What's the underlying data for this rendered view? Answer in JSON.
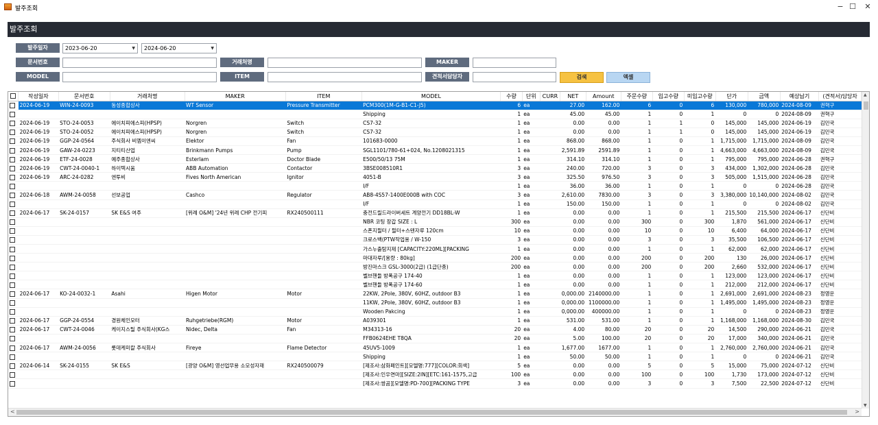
{
  "window": {
    "title": "발주조회",
    "min": "−",
    "max": "☐",
    "close": "✕"
  },
  "header": {
    "title": "발주조회"
  },
  "filters": {
    "order_date_label": "발주일자",
    "date_from": "2023-06-20",
    "date_to": "2024-06-20",
    "doc_no_label": "문서번호",
    "doc_no_value": "",
    "vendor_label": "거래처명",
    "vendor_value": "",
    "maker_label": "MAKER",
    "maker_value": "",
    "model_label": "MODEL",
    "model_value": "",
    "item_label": "ITEM",
    "item_value": "",
    "quote_mgr_label": "견적서담당자",
    "quote_mgr_value": "",
    "search_button": "검색",
    "excel_button": "엑셀"
  },
  "grid": {
    "columns": [
      "작성일자",
      "문서번호",
      "거래처명",
      "MAKER",
      "ITEM",
      "MODEL",
      "수량",
      "단위",
      "CURR",
      "NET",
      "Amount",
      "주문수량",
      "입고수량",
      "미입고수량",
      "단가",
      "금액",
      "예상납기",
      "(견적서)담당자"
    ],
    "rows": [
      [
        "2024-06-19",
        "WIN-24-0093",
        "동성종합상사",
        "WT Sensor",
        "Pressure Transmitter",
        "PCM300(1M-G-B1-C1-J5)",
        "6",
        "ea",
        "",
        "27.00",
        "162.00",
        "6",
        "0",
        "6",
        "130,000",
        "780,000",
        "2024-08-09",
        "권혁구"
      ],
      [
        "",
        "",
        "",
        "",
        "",
        "Shipping",
        "1",
        "ea",
        "",
        "45.00",
        "45.00",
        "1",
        "0",
        "1",
        "0",
        "0",
        "2024-08-09",
        "권혁구"
      ],
      [
        "2024-06-19",
        "STO-24-0053",
        "에이치피에스피(HPSP)",
        "Norgren",
        "Switch",
        "CS7-32",
        "1",
        "ea",
        "",
        "0.00",
        "0.00",
        "1",
        "1",
        "0",
        "145,000",
        "145,000",
        "2024-06-19",
        "김민국"
      ],
      [
        "2024-06-19",
        "STO-24-0052",
        "에이치피에스피(HPSP)",
        "Norgren",
        "Switch",
        "CS7-32",
        "1",
        "ea",
        "",
        "0.00",
        "0.00",
        "1",
        "1",
        "0",
        "145,000",
        "145,000",
        "2024-06-19",
        "김민국"
      ],
      [
        "2024-06-19",
        "GGP-24-0564",
        "주식회사 비엠이엔씨",
        "Elektor",
        "Fan",
        "101683-0000",
        "1",
        "ea",
        "",
        "868.00",
        "868.00",
        "1",
        "0",
        "1",
        "1,715,000",
        "1,715,000",
        "2024-08-09",
        "김민국"
      ],
      [
        "2024-06-19",
        "GAW-24-0223",
        "지티티산업",
        "Brinkmann Pumps",
        "Pump",
        "SGL1101/780-61+024, No.1208021315",
        "1",
        "ea",
        "",
        "2,591.89",
        "2591.89",
        "1",
        "0",
        "1",
        "4,663,000",
        "4,663,000",
        "2024-08-09",
        "김민국"
      ],
      [
        "2024-06-19",
        "ETF-24-0028",
        "예주종합상사",
        "Esterlam",
        "Doctor Blade",
        "E500/50/13 75M",
        "1",
        "ea",
        "",
        "314.10",
        "314.10",
        "1",
        "0",
        "1",
        "795,000",
        "795,000",
        "2024-06-28",
        "권혁구"
      ],
      [
        "2024-06-19",
        "CWT-24-0040-1",
        "하이텍시움",
        "ABB Automation",
        "Contactor",
        "3BSE008510R1",
        "3",
        "ea",
        "",
        "240.00",
        "720.00",
        "3",
        "0",
        "3",
        "434,000",
        "1,302,000",
        "2024-06-28",
        "김민국"
      ],
      [
        "2024-06-19",
        "ARC-24-0282",
        "엔투비",
        "Fives North American",
        "Ignitor",
        "4051-B",
        "3",
        "ea",
        "",
        "325.50",
        "976.50",
        "3",
        "0",
        "3",
        "505,000",
        "1,515,000",
        "2024-06-28",
        "김민국"
      ],
      [
        "",
        "",
        "",
        "",
        "",
        "I/F",
        "1",
        "ea",
        "",
        "36.00",
        "36.00",
        "1",
        "0",
        "1",
        "0",
        "0",
        "2024-06-28",
        "김민국"
      ],
      [
        "2024-06-18",
        "AWM-24-0058",
        "선보공업",
        "Cashco",
        "Regulator",
        "AB8-4S57-1400E000B with COC",
        "3",
        "ea",
        "",
        "2,610.00",
        "7830.00",
        "3",
        "0",
        "3",
        "3,380,000",
        "10,140,000",
        "2024-08-02",
        "김민국"
      ],
      [
        "",
        "",
        "",
        "",
        "",
        "I/F",
        "1",
        "ea",
        "",
        "150.00",
        "150.00",
        "1",
        "0",
        "1",
        "0",
        "0",
        "2024-08-02",
        "김민국"
      ],
      [
        "2024-06-17",
        "SK-24-0157",
        "SK E&S 여주",
        "[위례 O&M] '24년 위례 CHP 전기피",
        "RX240500111",
        "충전드릴드라이버세트 계양전기 DD18BL-W",
        "1",
        "ea",
        "",
        "0.00",
        "0.00",
        "1",
        "0",
        "1",
        "215,500",
        "215,500",
        "2024-06-17",
        "신단비"
      ],
      [
        "",
        "",
        "",
        "",
        "",
        "NBR 코팅 장갑 SIZE : L",
        "300",
        "ea",
        "",
        "0.00",
        "0.00",
        "300",
        "0",
        "300",
        "1,870",
        "561,000",
        "2024-06-17",
        "신단비"
      ],
      [
        "",
        "",
        "",
        "",
        "",
        "스폰지필터 / 필터+스텐자루 120cm",
        "10",
        "ea",
        "",
        "0.00",
        "0.00",
        "10",
        "0",
        "10",
        "6,400",
        "64,000",
        "2024-06-17",
        "신단비"
      ],
      [
        "",
        "",
        "",
        "",
        "",
        "크로스백(PTW작업용 / W-150",
        "3",
        "ea",
        "",
        "0.00",
        "0.00",
        "3",
        "0",
        "3",
        "35,500",
        "106,500",
        "2024-06-17",
        "신단비"
      ],
      [
        "",
        "",
        "",
        "",
        "",
        "가스누출탐지제 [CAPACITY:220ML][PACKING",
        "1",
        "ea",
        "",
        "0.00",
        "0.00",
        "1",
        "0",
        "1",
        "62,000",
        "62,000",
        "2024-06-17",
        "신단비"
      ],
      [
        "",
        "",
        "",
        "",
        "",
        "마대자루/[용량 : 80kg]",
        "200",
        "ea",
        "",
        "0.00",
        "0.00",
        "200",
        "0",
        "200",
        "130",
        "26,000",
        "2024-06-17",
        "신단비"
      ],
      [
        "",
        "",
        "",
        "",
        "",
        "방진마스크 GSL-3000(2급) (1급단종)",
        "200",
        "ea",
        "",
        "0.00",
        "0.00",
        "200",
        "0",
        "200",
        "2,660",
        "532,000",
        "2024-06-17",
        "신단비"
      ],
      [
        "",
        "",
        "",
        "",
        "",
        "벨브핸들 방폭공구 174-40",
        "1",
        "ea",
        "",
        "0.00",
        "0.00",
        "1",
        "0",
        "1",
        "123,000",
        "123,000",
        "2024-06-17",
        "신단비"
      ],
      [
        "",
        "",
        "",
        "",
        "",
        "벨브핸들 방폭공구 174-60",
        "1",
        "ea",
        "",
        "0.00",
        "0.00",
        "1",
        "0",
        "1",
        "212,000",
        "212,000",
        "2024-06-17",
        "신단비"
      ],
      [
        "2024-06-17",
        "KO-24-0032-1",
        "Asahi",
        "Higen Motor",
        "Motor",
        "22KW, 2Pole, 380V, 60HZ, outdoor B3",
        "1",
        "ea",
        "",
        "0,000.00",
        "2140000.00",
        "1",
        "0",
        "1",
        "2,691,000",
        "2,691,000",
        "2024-08-23",
        "정영운"
      ],
      [
        "",
        "",
        "",
        "",
        "",
        "11KW, 2Pole, 380V, 60HZ, outdoor B3",
        "1",
        "ea",
        "",
        "0,000.00",
        "1100000.00",
        "1",
        "0",
        "1",
        "1,495,000",
        "1,495,000",
        "2024-08-23",
        "정영운"
      ],
      [
        "",
        "",
        "",
        "",
        "",
        "Wooden Pakcing",
        "1",
        "ea",
        "",
        "0,000.00",
        "400000.00",
        "1",
        "0",
        "1",
        "0",
        "0",
        "2024-08-23",
        "정영운"
      ],
      [
        "2024-06-17",
        "GGP-24-0554",
        "경원체인모터",
        "Ruhgetriebe(RGM)",
        "Motor",
        "A039301",
        "1",
        "ea",
        "",
        "531.00",
        "531.00",
        "1",
        "0",
        "1",
        "1,168,000",
        "1,168,000",
        "2024-08-30",
        "김민국"
      ],
      [
        "2024-06-17",
        "CWT-24-0046",
        "케이지스틸 주식회사(KG스",
        "Nidec, Delta",
        "Fan",
        "M34313-16",
        "20",
        "ea",
        "",
        "4.00",
        "80.00",
        "20",
        "0",
        "20",
        "14,500",
        "290,000",
        "2024-06-21",
        "김민국"
      ],
      [
        "",
        "",
        "",
        "",
        "",
        "FFB0624EHE T8QA",
        "20",
        "ea",
        "",
        "5.00",
        "100.00",
        "20",
        "0",
        "20",
        "17,000",
        "340,000",
        "2024-06-21",
        "김민국"
      ],
      [
        "2024-06-17",
        "AWM-24-0056",
        "롯데케미칼 주식회사",
        "Fireye",
        "Flame Detector",
        "45UV5-1009",
        "1",
        "ea",
        "",
        "1,677.00",
        "1677.00",
        "1",
        "0",
        "1",
        "2,760,000",
        "2,760,000",
        "2024-06-21",
        "김민국"
      ],
      [
        "",
        "",
        "",
        "",
        "",
        "Shipping",
        "1",
        "ea",
        "",
        "50.00",
        "50.00",
        "1",
        "0",
        "1",
        "0",
        "0",
        "2024-06-21",
        "김민국"
      ],
      [
        "2024-06-14",
        "SK-24-0155",
        "SK E&S",
        "[광양 O&M] 영선업무용 소모성자재",
        "RX240500079",
        "[제조사:삼화페인트][모델명:777][COLOR:회색]",
        "5",
        "ea",
        "",
        "0.00",
        "0.00",
        "5",
        "0",
        "5",
        "15,000",
        "75,000",
        "2024-07-12",
        "신단비"
      ],
      [
        "",
        "",
        "",
        "",
        "",
        "[제조사:인우연마][SIZE:2IN][ETC:161-1575,고급",
        "100",
        "ea",
        "",
        "0.00",
        "0.00",
        "100",
        "0",
        "100",
        "1,730",
        "173,000",
        "2024-07-12",
        "신단비"
      ],
      [
        "",
        "",
        "",
        "",
        "",
        "[제조사:쌍곰][모델명:PD-700][PACKING TYPE",
        "3",
        "ea",
        "",
        "0.00",
        "0.00",
        "3",
        "0",
        "3",
        "7,500",
        "22,500",
        "2024-07-12",
        "신단비"
      ]
    ]
  },
  "scroll": {
    "up": "▲",
    "down": "▼",
    "left": "<",
    "right": ">"
  }
}
